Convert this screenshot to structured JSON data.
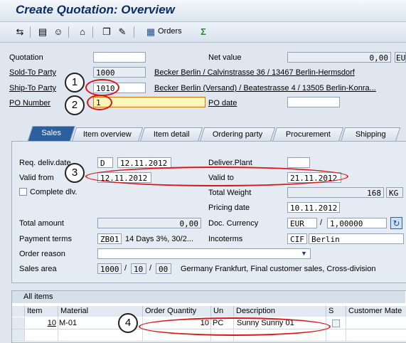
{
  "title": "Create Quotation: Overview",
  "toolbar": {
    "orders_label": "Orders"
  },
  "header": {
    "quotation_label": "Quotation",
    "quotation_value": "",
    "net_value_label": "Net value",
    "net_value": "0,00",
    "currency": "EU",
    "sold_to_label": "Sold-To Party",
    "sold_to_value": "1000",
    "sold_to_desc": "Becker Berlin / Calvinstrasse 36 / 13467 Berlin-Hermsdorf",
    "ship_to_label": "Ship-To Party",
    "ship_to_value": "1010",
    "ship_to_desc": "Becker Berlin (Versand) / Beatestrasse 4 / 13505 Berlin-Konra...",
    "po_number_label": "PO Number",
    "po_number_value": "1",
    "po_date_label": "PO date",
    "po_date_value": ""
  },
  "tabs": [
    "Sales",
    "Item overview",
    "Item detail",
    "Ordering party",
    "Procurement",
    "Shipping"
  ],
  "sales": {
    "req_deliv_label": "Req. deliv.date",
    "req_deliv_type": "D",
    "req_deliv_value": "12.11.2012",
    "deliver_plant_label": "Deliver.Plant",
    "deliver_plant_value": "",
    "valid_from_label": "Valid from",
    "valid_from_value": "12.11.2012",
    "valid_to_label": "Valid to",
    "valid_to_value": "21.11.2012",
    "complete_dlv_label": "Complete dlv.",
    "total_weight_label": "Total Weight",
    "total_weight_value": "168",
    "weight_unit": "KG",
    "pricing_date_label": "Pricing date",
    "pricing_date_value": "10.11.2012",
    "total_amount_label": "Total amount",
    "total_amount_value": "0,00",
    "doc_currency_label": "Doc. Currency",
    "doc_currency_value": "EUR",
    "exchange_sep": "/",
    "exchange_rate": "1,00000",
    "payment_terms_label": "Payment terms",
    "payment_terms_code": "ZB01",
    "payment_terms_desc": "14 Days 3%, 30/2...",
    "incoterms_label": "Incoterms",
    "incoterms_code": "CIF",
    "incoterms_place": "Berlin",
    "order_reason_label": "Order reason",
    "order_reason_value": "",
    "sales_area_label": "Sales area",
    "sales_org": "1000",
    "dist_channel": "10",
    "division": "00",
    "area_sep": "/",
    "sales_area_desc": "Germany Frankfurt, Final customer sales, Cross-division"
  },
  "items": {
    "title": "All items",
    "columns": [
      "Item",
      "Material",
      "Order Quantity",
      "Un",
      "Description",
      "S",
      "Customer Mate"
    ],
    "rows": [
      {
        "item": "10",
        "material": "M-01",
        "qty": "10",
        "unit": "PC",
        "desc": "Sunny Sunny 01"
      }
    ]
  },
  "annotations": [
    "1",
    "2",
    "3",
    "4"
  ],
  "colors": {
    "accent": "#2b5f9e",
    "annotation": "#d81818",
    "title": "#0b2d63"
  }
}
